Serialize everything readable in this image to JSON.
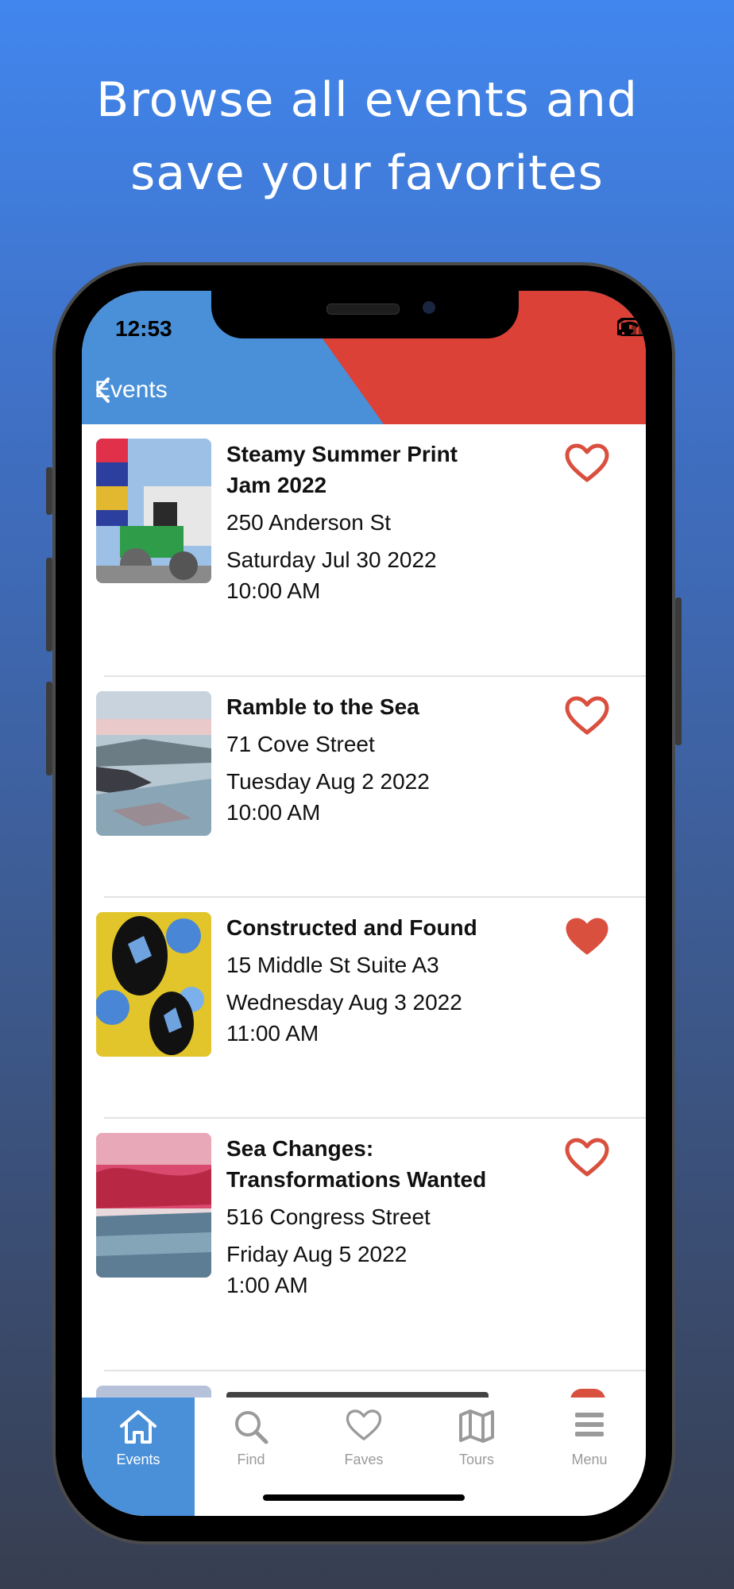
{
  "headline": {
    "line1": "Browse all events and",
    "line2": "save your favorites"
  },
  "status_bar": {
    "time": "12:53"
  },
  "nav": {
    "back_label": "Events"
  },
  "colors": {
    "accent_blue": "#4A90D9",
    "accent_dark_blue": "#0F4D87",
    "accent_red": "#DB4137",
    "heart_red": "#D9503F"
  },
  "events": [
    {
      "title_line1": "Steamy Summer Print",
      "title_line2": "Jam 2022",
      "address": "250 Anderson St",
      "date": "Saturday Jul 30 2022",
      "time": "10:00 AM",
      "favorite": false
    },
    {
      "title_line1": "Ramble to the Sea",
      "title_line2": "",
      "address": "71 Cove Street",
      "date": "Tuesday Aug 2 2022",
      "time": "10:00 AM",
      "favorite": false
    },
    {
      "title_line1": "Constructed and Found",
      "title_line2": "",
      "address": "15 Middle St Suite A3",
      "date": "Wednesday Aug 3 2022",
      "time": "11:00 AM",
      "favorite": true
    },
    {
      "title_line1": "Sea Changes:",
      "title_line2": "Transformations Wanted",
      "address": "516 Congress Street",
      "date": "Friday Aug 5 2022",
      "time": "1:00 AM",
      "favorite": false
    }
  ],
  "tabs": [
    {
      "label": "Events",
      "icon": "home-icon",
      "active": true
    },
    {
      "label": "Find",
      "icon": "search-icon",
      "active": false
    },
    {
      "label": "Faves",
      "icon": "heart-icon",
      "active": false
    },
    {
      "label": "Tours",
      "icon": "map-icon",
      "active": false
    },
    {
      "label": "Menu",
      "icon": "menu-icon",
      "active": false
    }
  ]
}
